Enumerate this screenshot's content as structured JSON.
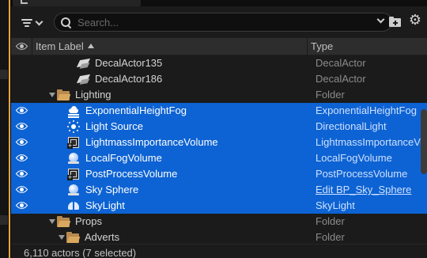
{
  "outliner": {
    "search": {
      "placeholder": "Search..."
    },
    "columns": {
      "label": "Item Label",
      "type": "Type"
    },
    "rows": [
      {
        "label": "DecalActor135",
        "type": "DecalActor",
        "icon": "decal-icon",
        "selected": false
      },
      {
        "label": "DecalActor186",
        "type": "DecalActor",
        "icon": "decal-icon",
        "selected": false
      },
      {
        "label": "Lighting",
        "type": "Folder",
        "icon": "folder-icon",
        "selected": false
      },
      {
        "label": "ExponentialHeightFog",
        "type": "ExponentialHeightFog",
        "icon": "fog-icon",
        "selected": true
      },
      {
        "label": "Light Source",
        "type": "DirectionalLight",
        "icon": "sun-icon",
        "selected": true
      },
      {
        "label": "LightmassImportanceVolume",
        "type": "LightmassImportanceVolume",
        "icon": "volume-icon",
        "selected": true
      },
      {
        "label": "LocalFogVolume",
        "type": "LocalFogVolume",
        "icon": "sphere-icon",
        "selected": true
      },
      {
        "label": "PostProcessVolume",
        "type": "PostProcessVolume",
        "icon": "volume-icon",
        "selected": true
      },
      {
        "label": "Sky Sphere",
        "type": "Edit BP_Sky_Sphere",
        "icon": "sphere-icon",
        "selected": true
      },
      {
        "label": "SkyLight",
        "type": "SkyLight",
        "icon": "skylight-icon",
        "selected": true
      },
      {
        "label": "Props",
        "type": "Folder",
        "icon": "folder-icon",
        "selected": false
      },
      {
        "label": "Adverts",
        "type": "Folder",
        "icon": "folder-icon",
        "selected": false
      }
    ],
    "status": "6,110 actors (7 selected)"
  },
  "colors": {
    "selection": "#0d63d3",
    "accent": "#e8a33a",
    "folder": "#d9a85f"
  }
}
